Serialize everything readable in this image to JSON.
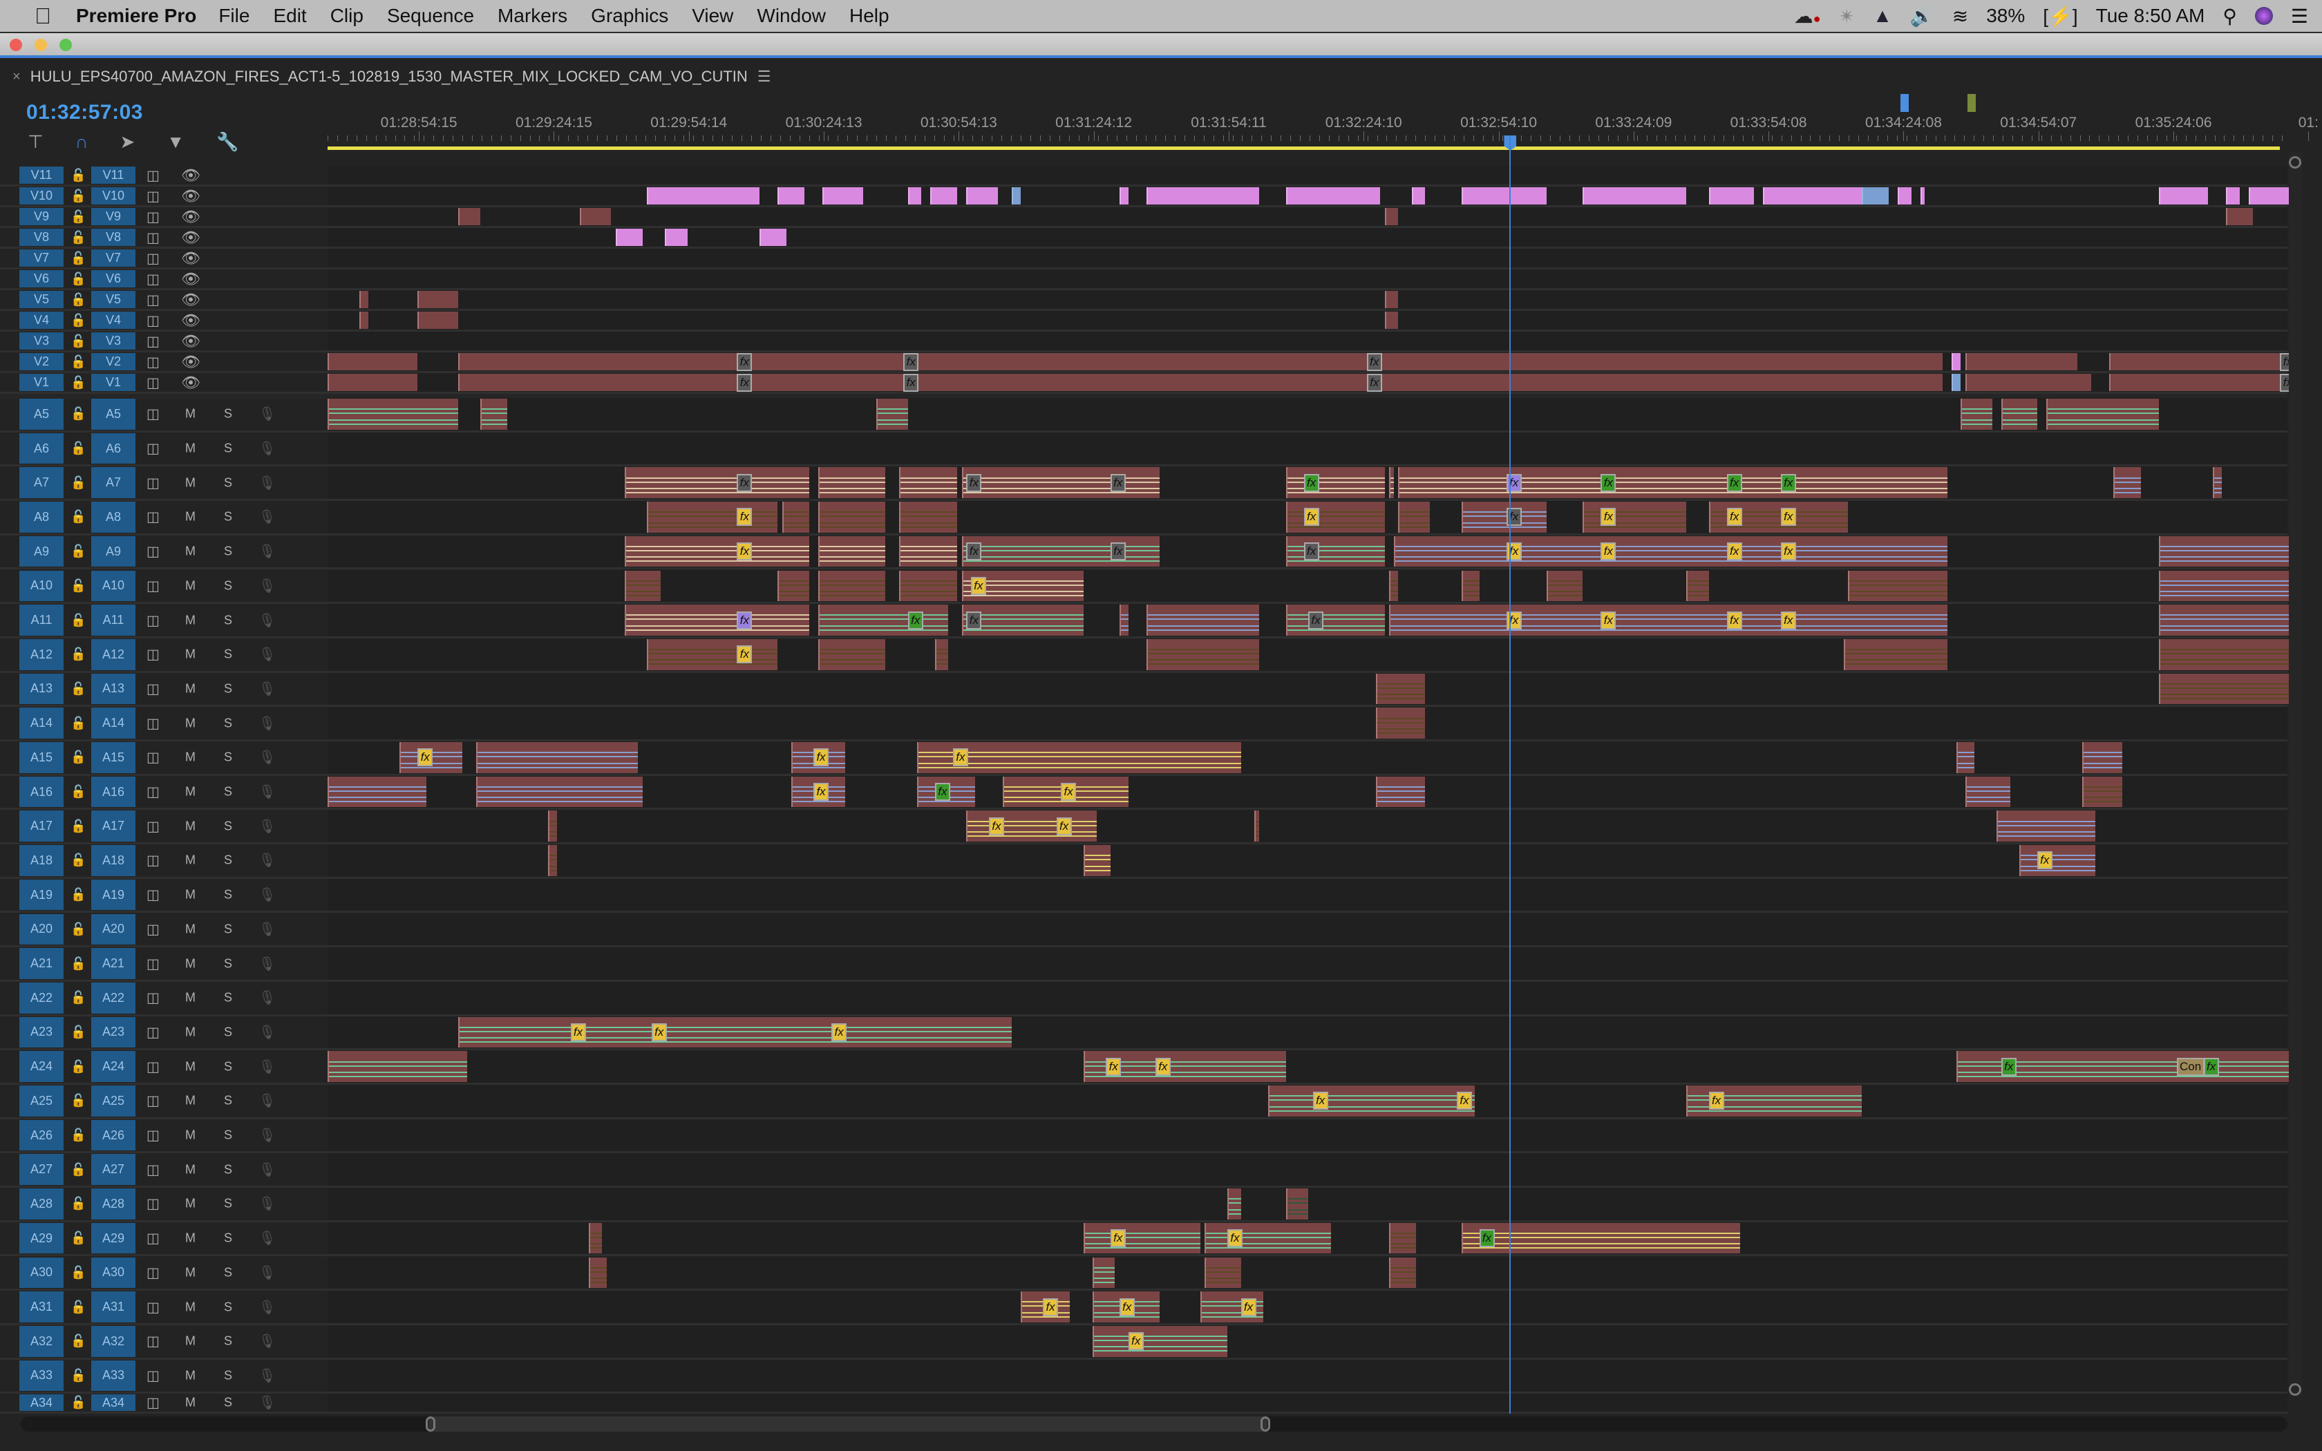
{
  "menubar": {
    "app_name": "Premiere Pro",
    "items": [
      "File",
      "Edit",
      "Clip",
      "Sequence",
      "Markers",
      "Graphics",
      "View",
      "Window",
      "Help"
    ],
    "status": {
      "battery": "38%",
      "clock": "Tue 8:50 AM"
    },
    "status_icons": [
      "creative-cloud-icon",
      "pinwheel-icon",
      "drive-icon",
      "volume-icon",
      "wifi-icon",
      "battery-icon",
      "spotlight-search-icon",
      "siri-icon",
      "notification-center-icon"
    ]
  },
  "panel": {
    "sequence_name": "HULU_EPS40700_AMAZON_FIRES_ACT1-5_102819_1530_MASTER_MIX_LOCKED_CAM_VO_CUTIN",
    "timecode": "01:32:57:03",
    "tools": [
      "insert-nest-icon",
      "snap-icon",
      "linked-selection-icon",
      "add-marker-icon",
      "settings-wrench-icon"
    ]
  },
  "ruler": {
    "labels": [
      "01:28:54:15",
      "01:29:24:15",
      "01:29:54:14",
      "01:30:24:13",
      "01:30:54:13",
      "01:31:24:12",
      "01:31:54:11",
      "01:32:24:10",
      "01:32:54:10",
      "01:33:24:09",
      "01:33:54:08",
      "01:34:24:08",
      "01:34:54:07",
      "01:35:24:06",
      "01:"
    ],
    "label_seconds": [
      20.3,
      50.3,
      80.3,
      110.3,
      140.3,
      170.3,
      200.3,
      230.3,
      260.3,
      290.3,
      320.3,
      350.3,
      380.3,
      410.3,
      440.3
    ],
    "visible_seconds": 436,
    "work_area_end_seconds": 434,
    "playhead_seconds": 262.9,
    "markers": [
      {
        "seconds": 350.5,
        "color": "#4a8fe0"
      },
      {
        "seconds": 365.5,
        "color": "#7a8a3a"
      }
    ]
  },
  "colors": {
    "accent": "#3d7fd6",
    "timecode": "#4a9eea",
    "clip_video": "#7a4444",
    "clip_pink": "#d98ae0",
    "clip_blue": "#7a9fd0",
    "fx_yellow": "#e8c23a",
    "fx_green": "#3a9a2a",
    "fx_gray": "#5a5a5a",
    "fx_purple": "#9a80e0",
    "line_green": "#6fd6a0",
    "line_yellow": "#e8e070",
    "line_blue": "#8aa8e0",
    "line_cream": "#e8d8b0",
    "work_area": "#e6e04a"
  },
  "video_tracks": [
    {
      "name": "V11",
      "clips": []
    },
    {
      "name": "V10",
      "clips": [
        [
          71,
          96,
          "pink"
        ],
        [
          100,
          106,
          "pink"
        ],
        [
          110,
          119,
          "pink"
        ],
        [
          129,
          132,
          "pink"
        ],
        [
          134,
          140,
          "pink"
        ],
        [
          142,
          149,
          "pink"
        ],
        [
          152,
          154,
          "blue"
        ],
        [
          176,
          178,
          "pink"
        ],
        [
          182,
          207,
          "pink"
        ],
        [
          213,
          234,
          "pink"
        ],
        [
          241,
          244,
          "pink"
        ],
        [
          252,
          271,
          "pink"
        ],
        [
          279,
          302,
          "pink"
        ],
        [
          307,
          317,
          "pink"
        ],
        [
          319,
          341,
          "pink"
        ],
        [
          341,
          347,
          "blue"
        ],
        [
          349,
          352,
          "pink"
        ],
        [
          354,
          355,
          "pink"
        ],
        [
          407,
          418,
          "pink"
        ],
        [
          422,
          425,
          "pink"
        ],
        [
          427,
          436,
          "pink"
        ]
      ]
    },
    {
      "name": "V9",
      "clips": [
        [
          29,
          34,
          "red"
        ],
        [
          56,
          63,
          "red"
        ],
        [
          235,
          238,
          "red"
        ],
        [
          422,
          428,
          "red"
        ]
      ]
    },
    {
      "name": "V8",
      "clips": [
        [
          64,
          70,
          "pink"
        ],
        [
          75,
          80,
          "pink"
        ],
        [
          96,
          102,
          "pink"
        ]
      ]
    },
    {
      "name": "V7",
      "clips": []
    },
    {
      "name": "V6",
      "clips": []
    },
    {
      "name": "V5",
      "clips": [
        [
          7,
          9,
          "red"
        ],
        [
          20,
          29,
          "red"
        ],
        [
          235,
          238,
          "red"
        ]
      ]
    },
    {
      "name": "V4",
      "clips": [
        [
          7,
          9,
          "red"
        ],
        [
          20,
          29,
          "red"
        ],
        [
          235,
          238,
          "red"
        ]
      ]
    },
    {
      "name": "V3",
      "clips": []
    },
    {
      "name": "V2",
      "clips": [
        [
          0,
          20,
          "red"
        ],
        [
          29,
          359,
          "red"
        ],
        [
          361,
          363,
          "pink"
        ],
        [
          364,
          389,
          "red"
        ],
        [
          396,
          436,
          "red"
        ]
      ],
      "fx": [
        [
          91,
          "gray"
        ],
        [
          128,
          "gray"
        ],
        [
          231,
          "gray"
        ],
        [
          434,
          "gray"
        ]
      ]
    },
    {
      "name": "V1",
      "clips": [
        [
          0,
          20,
          "red"
        ],
        [
          29,
          359,
          "red"
        ],
        [
          361,
          363,
          "blue"
        ],
        [
          364,
          392,
          "red"
        ],
        [
          396,
          436,
          "red"
        ]
      ],
      "fx": [
        [
          91,
          "gray"
        ],
        [
          128,
          "gray"
        ],
        [
          231,
          "gray"
        ],
        [
          434,
          "gray"
        ]
      ]
    }
  ],
  "audio_tracks": [
    {
      "name": "A5",
      "clips": [
        [
          0,
          29,
          "green"
        ],
        [
          34,
          40,
          "green"
        ],
        [
          122,
          129,
          "green"
        ],
        [
          363,
          370,
          "green"
        ],
        [
          372,
          380,
          "green"
        ],
        [
          382,
          407,
          "green"
        ]
      ]
    },
    {
      "name": "A6",
      "clips": []
    },
    {
      "name": "A7",
      "clips": [
        [
          66,
          107,
          "cream"
        ],
        [
          109,
          124,
          "cream"
        ],
        [
          127,
          140,
          "cream"
        ],
        [
          141,
          185,
          "cream"
        ],
        [
          213,
          235,
          "cream"
        ],
        [
          236,
          237,
          "cream"
        ],
        [
          238,
          360,
          "cream"
        ],
        [
          397,
          403,
          "blue"
        ],
        [
          419,
          421,
          "blue"
        ]
      ],
      "fx": [
        [
          91,
          "gray"
        ],
        [
          142,
          "gray"
        ],
        [
          174,
          "gray"
        ],
        [
          217,
          "green"
        ],
        [
          262,
          "purple"
        ],
        [
          283,
          "green"
        ],
        [
          311,
          "green"
        ],
        [
          323,
          "green"
        ]
      ]
    },
    {
      "name": "A8",
      "clips": [
        [
          71,
          100,
          "brown"
        ],
        [
          101,
          107,
          "brown"
        ],
        [
          109,
          124,
          "brown"
        ],
        [
          127,
          140,
          "brown"
        ],
        [
          213,
          235,
          "brown"
        ],
        [
          238,
          245,
          "brown"
        ],
        [
          252,
          271,
          "blue"
        ],
        [
          279,
          302,
          "brown"
        ],
        [
          307,
          338,
          "brown"
        ]
      ],
      "fx": [
        [
          91,
          "yellow"
        ],
        [
          217,
          "yellow"
        ],
        [
          262,
          "gray"
        ],
        [
          283,
          "yellow"
        ],
        [
          311,
          "yellow"
        ],
        [
          323,
          "yellow"
        ]
      ]
    },
    {
      "name": "A9",
      "clips": [
        [
          66,
          107,
          "cream"
        ],
        [
          109,
          124,
          "cream"
        ],
        [
          127,
          140,
          "cream"
        ],
        [
          141,
          185,
          "green"
        ],
        [
          213,
          235,
          "green"
        ],
        [
          237,
          360,
          "blue"
        ],
        [
          407,
          436,
          "blue"
        ]
      ],
      "fx": [
        [
          91,
          "yellow"
        ],
        [
          142,
          "gray"
        ],
        [
          174,
          "gray"
        ],
        [
          217,
          "gray"
        ],
        [
          262,
          "yellow"
        ],
        [
          283,
          "yellow"
        ],
        [
          311,
          "yellow"
        ],
        [
          323,
          "yellow"
        ]
      ]
    },
    {
      "name": "A10",
      "clips": [
        [
          66,
          74,
          "brown"
        ],
        [
          100,
          107,
          "brown"
        ],
        [
          109,
          124,
          "brown"
        ],
        [
          127,
          140,
          "brown"
        ],
        [
          141,
          168,
          "cream"
        ],
        [
          236,
          238,
          "brown"
        ],
        [
          252,
          256,
          "brown"
        ],
        [
          271,
          279,
          "brown"
        ],
        [
          302,
          307,
          "brown"
        ],
        [
          338,
          360,
          "brown"
        ],
        [
          407,
          436,
          "blue"
        ]
      ],
      "fx": [
        [
          143,
          "yellow"
        ]
      ]
    },
    {
      "name": "A11",
      "clips": [
        [
          66,
          107,
          "cream"
        ],
        [
          109,
          138,
          "green"
        ],
        [
          141,
          168,
          "green"
        ],
        [
          176,
          178,
          "blue"
        ],
        [
          182,
          207,
          "blue"
        ],
        [
          213,
          235,
          "green"
        ],
        [
          236,
          360,
          "blue"
        ],
        [
          407,
          436,
          "blue"
        ]
      ],
      "fx": [
        [
          91,
          "purple"
        ],
        [
          129,
          "green"
        ],
        [
          142,
          "gray"
        ],
        [
          218,
          "gray"
        ],
        [
          262,
          "yellow"
        ],
        [
          283,
          "yellow"
        ],
        [
          311,
          "yellow"
        ],
        [
          323,
          "yellow"
        ]
      ]
    },
    {
      "name": "A12",
      "clips": [
        [
          71,
          100,
          "brown"
        ],
        [
          109,
          124,
          "brown"
        ],
        [
          135,
          138,
          "brown"
        ],
        [
          182,
          207,
          "brown"
        ],
        [
          337,
          360,
          "brown"
        ],
        [
          407,
          436,
          "brown"
        ]
      ],
      "fx": [
        [
          91,
          "yellow"
        ]
      ]
    },
    {
      "name": "A13",
      "clips": [
        [
          233,
          244,
          "brown"
        ],
        [
          407,
          436,
          "brown"
        ]
      ]
    },
    {
      "name": "A14",
      "clips": [
        [
          233,
          244,
          "brown"
        ]
      ]
    },
    {
      "name": "A15",
      "clips": [
        [
          16,
          30,
          "blue"
        ],
        [
          33,
          69,
          "blue"
        ],
        [
          103,
          115,
          "blue"
        ],
        [
          131,
          203,
          "yellow"
        ],
        [
          362,
          366,
          "blue"
        ],
        [
          390,
          399,
          "blue"
        ]
      ],
      "fx": [
        [
          20,
          "yellow"
        ],
        [
          108,
          "yellow"
        ],
        [
          139,
          "yellow"
        ]
      ]
    },
    {
      "name": "A16",
      "clips": [
        [
          0,
          22,
          "blue"
        ],
        [
          33,
          70,
          "blue"
        ],
        [
          103,
          115,
          "blue"
        ],
        [
          131,
          144,
          "blue"
        ],
        [
          150,
          178,
          "yellow"
        ],
        [
          233,
          244,
          "blue"
        ],
        [
          364,
          374,
          "blue"
        ],
        [
          390,
          399,
          "brown"
        ]
      ],
      "fx": [
        [
          108,
          "yellow"
        ],
        [
          135,
          "green"
        ],
        [
          163,
          "yellow"
        ]
      ]
    },
    {
      "name": "A17",
      "clips": [
        [
          49,
          51,
          "brown"
        ],
        [
          142,
          171,
          "yellow"
        ],
        [
          206,
          207,
          "brown"
        ],
        [
          371,
          393,
          "blue"
        ]
      ],
      "fx": [
        [
          147,
          "yellow"
        ],
        [
          162,
          "yellow"
        ]
      ]
    },
    {
      "name": "A18",
      "clips": [
        [
          49,
          51,
          "brown"
        ],
        [
          168,
          174,
          "yellow"
        ],
        [
          376,
          393,
          "blue"
        ]
      ],
      "fx": [
        [
          380,
          "yellow"
        ]
      ]
    },
    {
      "name": "A19",
      "clips": []
    },
    {
      "name": "A20",
      "clips": []
    },
    {
      "name": "A21",
      "clips": []
    },
    {
      "name": "A22",
      "clips": []
    },
    {
      "name": "A23",
      "clips": [
        [
          29,
          152,
          "green"
        ]
      ],
      "fx": [
        [
          54,
          "yellow"
        ],
        [
          72,
          "yellow"
        ],
        [
          112,
          "yellow"
        ]
      ]
    },
    {
      "name": "A24",
      "clips": [
        [
          0,
          31,
          "green"
        ],
        [
          168,
          213,
          "green"
        ],
        [
          362,
          436,
          "green"
        ]
      ],
      "fx": [
        [
          173,
          "yellow"
        ],
        [
          184,
          "yellow"
        ],
        [
          372,
          "green"
        ],
        [
          417,
          "green"
        ]
      ]
    },
    {
      "name": "A25",
      "clips": [
        [
          209,
          255,
          "green"
        ],
        [
          302,
          341,
          "green"
        ]
      ],
      "fx": [
        [
          219,
          "yellow"
        ],
        [
          251,
          "yellow"
        ],
        [
          307,
          "yellow"
        ]
      ]
    },
    {
      "name": "A26",
      "clips": []
    },
    {
      "name": "A27",
      "clips": []
    },
    {
      "name": "A28",
      "clips": [
        [
          200,
          203,
          "green"
        ],
        [
          213,
          218,
          "dkgreen"
        ]
      ]
    },
    {
      "name": "A29",
      "clips": [
        [
          58,
          61,
          "brown"
        ],
        [
          168,
          194,
          "green"
        ],
        [
          195,
          223,
          "green"
        ],
        [
          236,
          242,
          "brown"
        ],
        [
          252,
          314,
          "yellow"
        ]
      ],
      "fx": [
        [
          174,
          "yellow"
        ],
        [
          200,
          "yellow"
        ],
        [
          256,
          "green"
        ]
      ]
    },
    {
      "name": "A30",
      "clips": [
        [
          58,
          62,
          "brown"
        ],
        [
          170,
          175,
          "green"
        ],
        [
          195,
          203,
          "brown"
        ],
        [
          236,
          242,
          "brown"
        ]
      ]
    },
    {
      "name": "A31",
      "clips": [
        [
          154,
          165,
          "yellow"
        ],
        [
          170,
          185,
          "green"
        ],
        [
          194,
          208,
          "green"
        ]
      ],
      "fx": [
        [
          159,
          "yellow"
        ],
        [
          176,
          "yellow"
        ],
        [
          203,
          "yellow"
        ]
      ]
    },
    {
      "name": "A32",
      "clips": [
        [
          170,
          200,
          "green"
        ]
      ],
      "fx": [
        [
          178,
          "yellow"
        ]
      ]
    },
    {
      "name": "A33",
      "clips": []
    },
    {
      "name": "A34",
      "clips": []
    }
  ],
  "labels": {
    "mute": "M",
    "solo": "S",
    "fx": "fx",
    "con": "Con"
  },
  "scroll": {
    "h_thumb_start": 0.18,
    "h_thumb_end": 0.55
  }
}
